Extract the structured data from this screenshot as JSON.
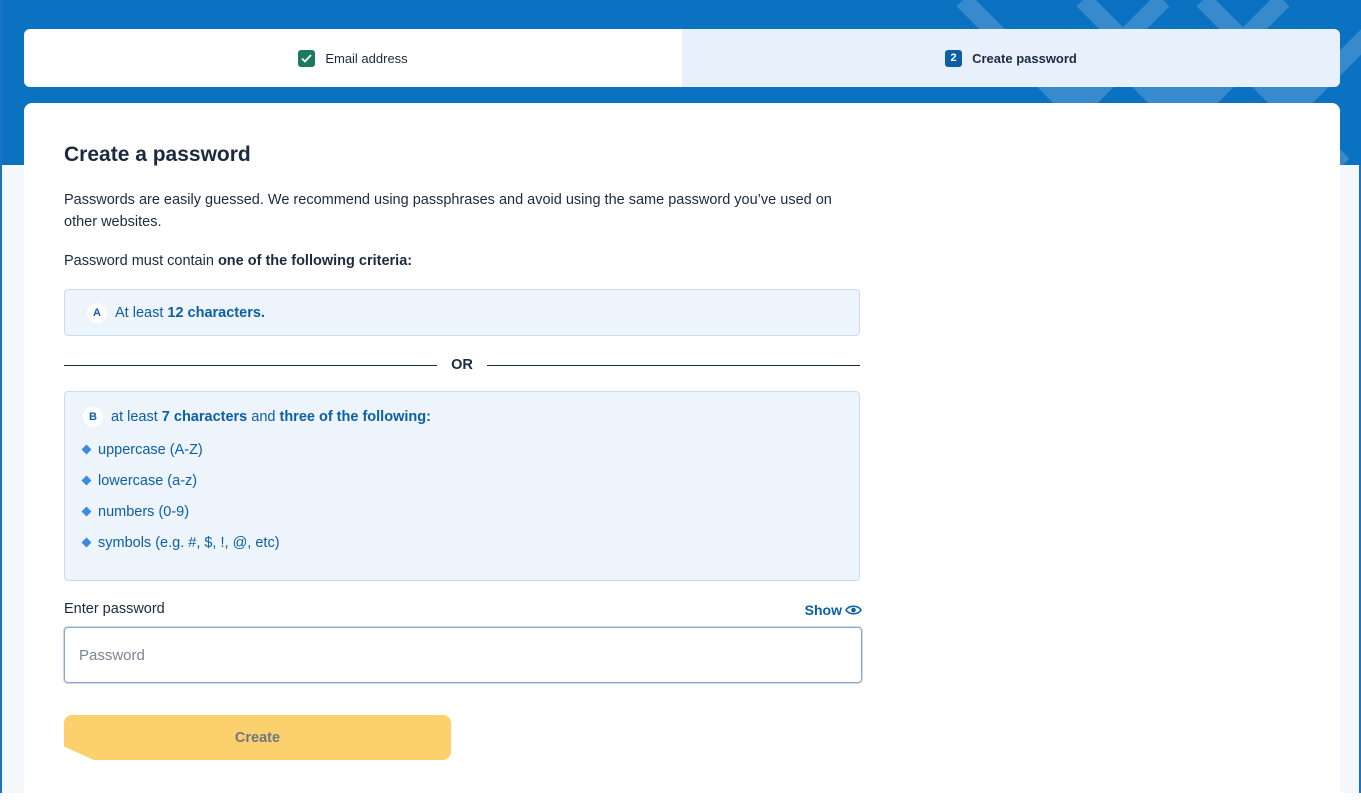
{
  "stepper": {
    "steps": [
      {
        "label": "Email address",
        "status": "complete"
      },
      {
        "number": "2",
        "label": "Create password",
        "status": "active"
      }
    ]
  },
  "form": {
    "title": "Create a password",
    "intro": "Passwords are easily guessed. We recommend using passphrases and avoid using the same password you’ve used on other websites.",
    "criteria_prefix": "Password must contain ",
    "criteria_strong": "one of the following criteria:",
    "option_a": {
      "badge": "A",
      "prefix": "At least ",
      "strong": "12 characters."
    },
    "or_label": "OR",
    "option_b": {
      "badge": "B",
      "prefix": "at least ",
      "strong1": "7 characters",
      "middle": " and ",
      "strong2": "three of the following:",
      "items": [
        "uppercase (A-Z)",
        "lowercase (a-z)",
        "numbers (0-9)",
        "symbols (e.g. #, $, !, @, etc)"
      ]
    },
    "password_label": "Enter password",
    "show_label": "Show",
    "password_placeholder": "Password",
    "password_value": "",
    "create_label": "Create"
  },
  "colors": {
    "brand_blue": "#0b72c2",
    "link_blue": "#0b5ea8",
    "success_green": "#1c7a5e",
    "button_yellow": "#fdd06e"
  }
}
